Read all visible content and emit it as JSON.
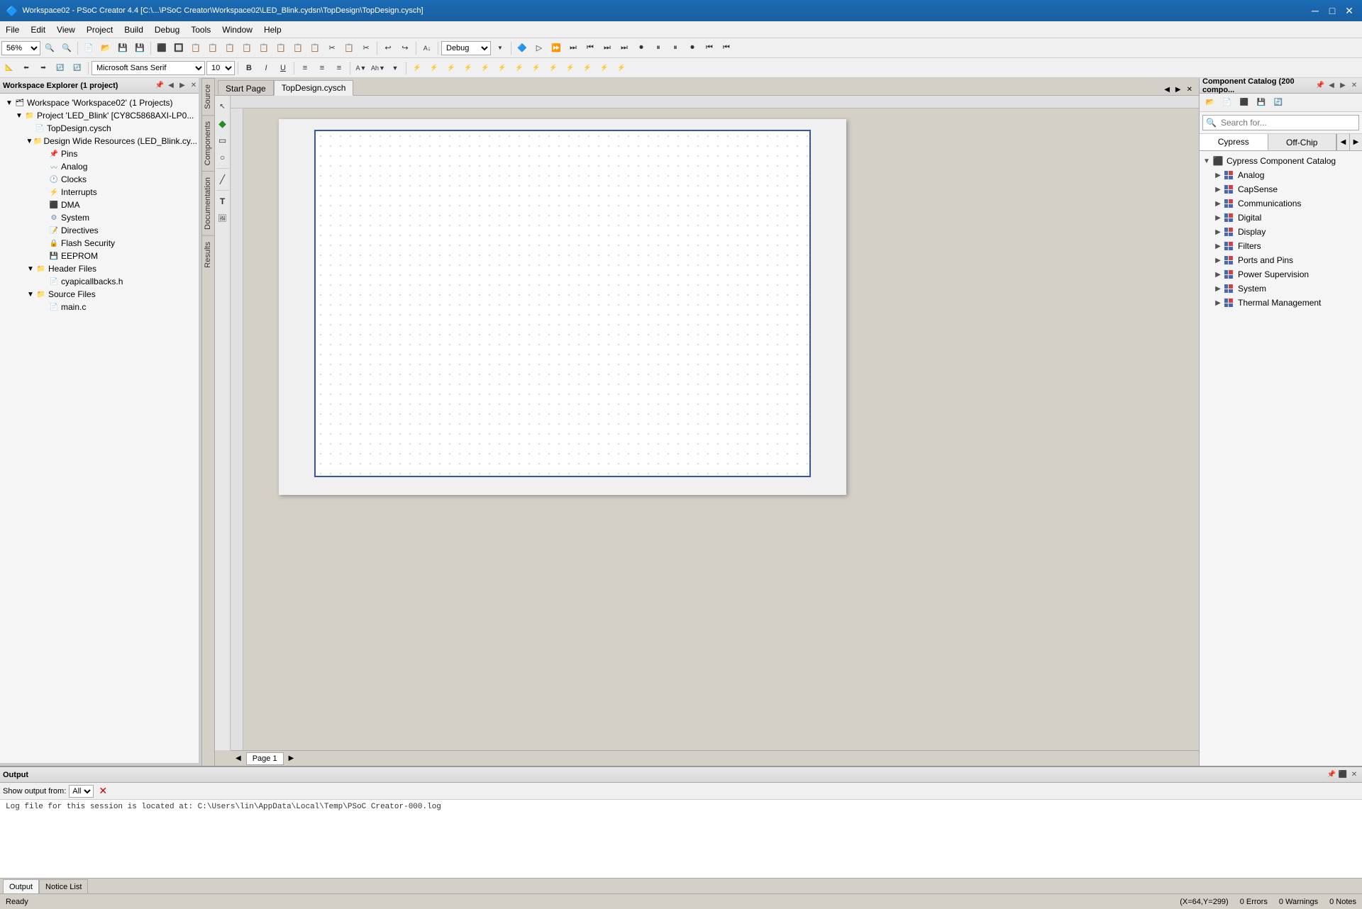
{
  "titleBar": {
    "title": "Workspace02 - PSoC Creator 4.4  [C:\\...\\PSoC Creator\\Workspace02\\LED_Blink.cydsn\\TopDesign\\TopDesign.cysch]",
    "iconLabel": "psoc-icon",
    "minimizeLabel": "─",
    "maximizeLabel": "□",
    "closeLabel": "✕"
  },
  "menuBar": {
    "items": [
      "File",
      "Edit",
      "View",
      "Project",
      "Build",
      "Debug",
      "Tools",
      "Window",
      "Help"
    ]
  },
  "toolbar1": {
    "zoom": "56%",
    "debugLabel": "Debug",
    "buttons": [
      "new",
      "open",
      "save",
      "saveall",
      "sep",
      "cut",
      "copy",
      "paste",
      "sep",
      "undo",
      "redo",
      "sep",
      "build",
      "rebuild",
      "clean",
      "sep",
      "debug",
      "stop"
    ]
  },
  "toolbar2": {
    "font": "Microsoft Sans Serif",
    "size": "10",
    "bold": "B",
    "italic": "I",
    "underline": "U"
  },
  "leftPanel": {
    "title": "Workspace Explorer (1 project)",
    "pinLabel": "📌",
    "closeLabel": "✕",
    "tree": {
      "workspace": "Workspace 'Workspace02' (1 Projects)",
      "project": "Project 'LED_Blink' [CY8C5868AXI-LP0...",
      "topDesign": "TopDesign.cysch",
      "designWide": "Design Wide Resources (LED_Blink.cy...",
      "pins": "Pins",
      "analog": "Analog",
      "clocks": "Clocks",
      "interrupts": "Interrupts",
      "dma": "DMA",
      "system": "System",
      "directives": "Directives",
      "flashSecurity": "Flash Security",
      "eeprom": "EEPROM",
      "headerFiles": "Header Files",
      "cyapicallbacks": "cyapicallbacks.h",
      "sourceFiles": "Source Files",
      "mainC": "main.c"
    }
  },
  "sideTabs": {
    "source": "Source",
    "components": "Components",
    "documentation": "Documentation",
    "results": "Results"
  },
  "tabs": {
    "startPage": "Start Page",
    "topDesign": "TopDesign.cysch",
    "activeTab": "topDesign"
  },
  "canvasPage": {
    "page1": "Page 1"
  },
  "rightPanel": {
    "title": "Component Catalog (200 compo...",
    "searchPlaceholder": "Search for...",
    "tabs": {
      "cypress": "Cypress",
      "offChip": "Off-Chip"
    },
    "catalogTitle": "Cypress Component Catalog",
    "items": [
      {
        "label": "Analog",
        "hasChildren": true
      },
      {
        "label": "CapSense",
        "hasChildren": true
      },
      {
        "label": "Communications",
        "hasChildren": true
      },
      {
        "label": "Digital",
        "hasChildren": true
      },
      {
        "label": "Display",
        "hasChildren": true
      },
      {
        "label": "Filters",
        "hasChildren": true
      },
      {
        "label": "Ports and Pins",
        "hasChildren": true
      },
      {
        "label": "Power Supervision",
        "hasChildren": true
      },
      {
        "label": "System",
        "hasChildren": true
      },
      {
        "label": "Thermal Management",
        "hasChildren": true
      }
    ]
  },
  "bottomPanel": {
    "title": "Output",
    "showOutputLabel": "Show output from:",
    "filterValue": "All",
    "logText": "Log file for this session is located at: C:\\Users\\lin\\AppData\\Local\\Temp\\PSoC Creator-000.log",
    "tabs": {
      "output": "Output",
      "noticeList": "Notice List"
    }
  },
  "statusBar": {
    "ready": "Ready",
    "coordinates": "(X=64,Y=299)",
    "errors": "0 Errors",
    "warnings": "0 Warnings",
    "notes": "0 Notes"
  }
}
